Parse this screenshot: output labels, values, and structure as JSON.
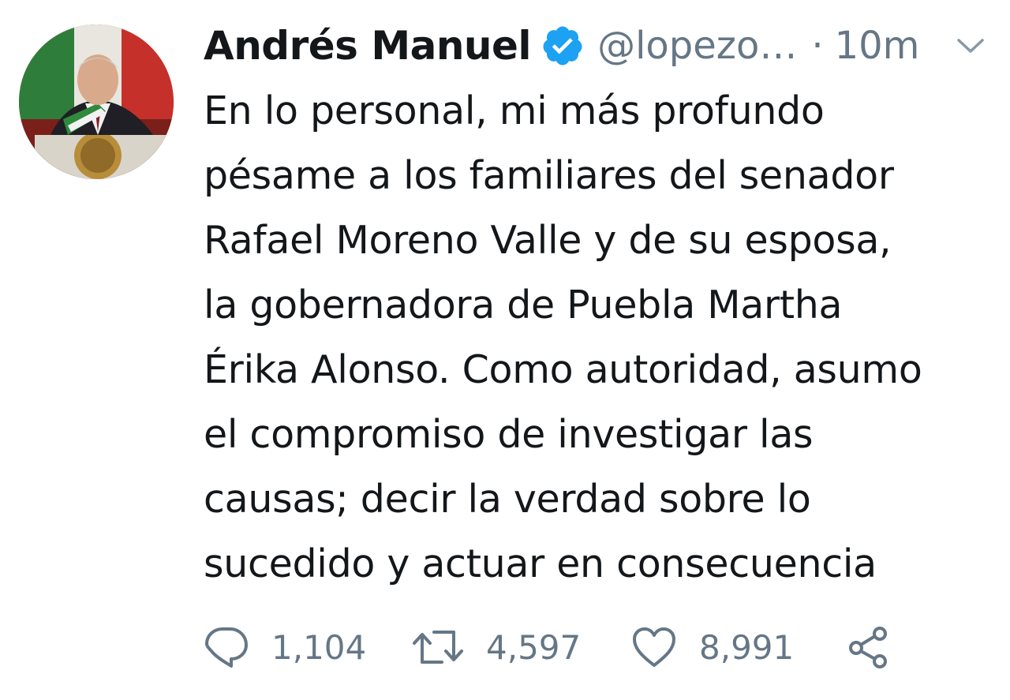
{
  "author": {
    "name": "Andrés Manuel",
    "handle": "@lopezo…",
    "separator": "·",
    "time": "10m",
    "verified": true,
    "avatar_icon": "profile-photo"
  },
  "tweet_lines": [
    "En lo personal, mi más profundo",
    "pésame a los familiares del senador",
    "Rafael Moreno Valle y de su esposa,",
    "la gobernadora de Puebla Martha",
    "Érika Alonso. Como autoridad, asumo",
    "el compromiso de investigar las",
    "causas; decir la verdad sobre lo",
    "sucedido y actuar en consecuencia"
  ],
  "actions": {
    "reply_count": "1,104",
    "retweet_count": "4,597",
    "like_count": "8,991"
  },
  "icons": {
    "verified": "verified-badge-icon",
    "caret": "chevron-down-icon",
    "reply": "reply-icon",
    "retweet": "retweet-icon",
    "like": "heart-icon",
    "share": "share-icon"
  },
  "colors": {
    "text": "#14171a",
    "secondary": "#657786",
    "verified_blue": "#1da1f2"
  }
}
